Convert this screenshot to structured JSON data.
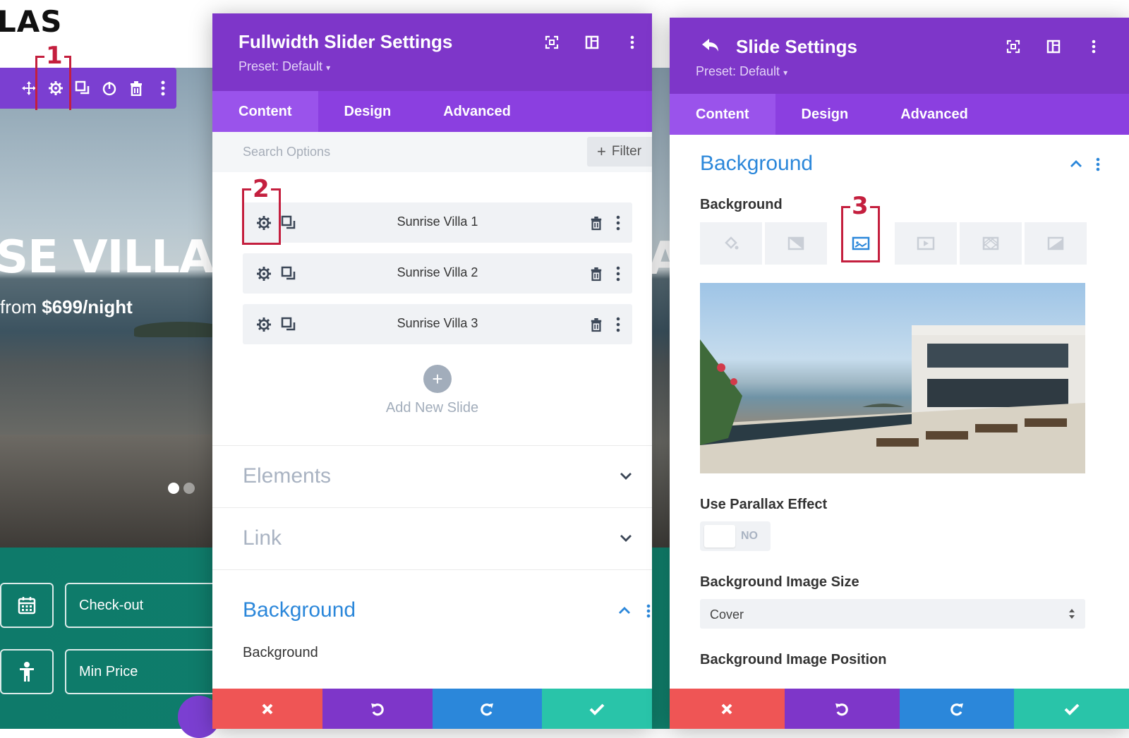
{
  "site": {
    "logo": "LAS",
    "hero_title": "SE VILLA",
    "hero_price_prefix": "from",
    "hero_price_value": "$699/night",
    "hero_right_letter": "A",
    "checkout_label": "Check-out",
    "min_price_label": "Min Price"
  },
  "callouts": {
    "one": "1",
    "two": "2",
    "three": "3"
  },
  "slider_panel": {
    "title": "Fullwidth Slider Settings",
    "preset": "Preset: Default",
    "tabs": [
      "Content",
      "Design",
      "Advanced"
    ],
    "search_placeholder": "Search Options",
    "filter_label": "Filter",
    "slides": [
      "Sunrise Villa 1",
      "Sunrise Villa 2",
      "Sunrise Villa 3"
    ],
    "add_slide_label": "Add New Slide",
    "sections": {
      "elements": "Elements",
      "link": "Link",
      "background": "Background"
    },
    "background_field_label": "Background"
  },
  "slide_panel": {
    "title": "Slide Settings",
    "preset": "Preset: Default",
    "tabs": [
      "Content",
      "Design",
      "Advanced"
    ],
    "section_title": "Background",
    "background_field_label": "Background",
    "parallax_label": "Use Parallax Effect",
    "parallax_value": "NO",
    "image_size_label": "Background Image Size",
    "image_size_value": "Cover",
    "image_position_label": "Background Image Position"
  },
  "colors": {
    "panel_header": "#7e36c9",
    "tab_bar": "#8b3fe0",
    "active_blue": "#2b87da",
    "cancel": "#ef5555",
    "undo": "#7e36c9",
    "redo": "#2b87da",
    "save": "#29c4a9",
    "callout": "#c41f3e"
  }
}
